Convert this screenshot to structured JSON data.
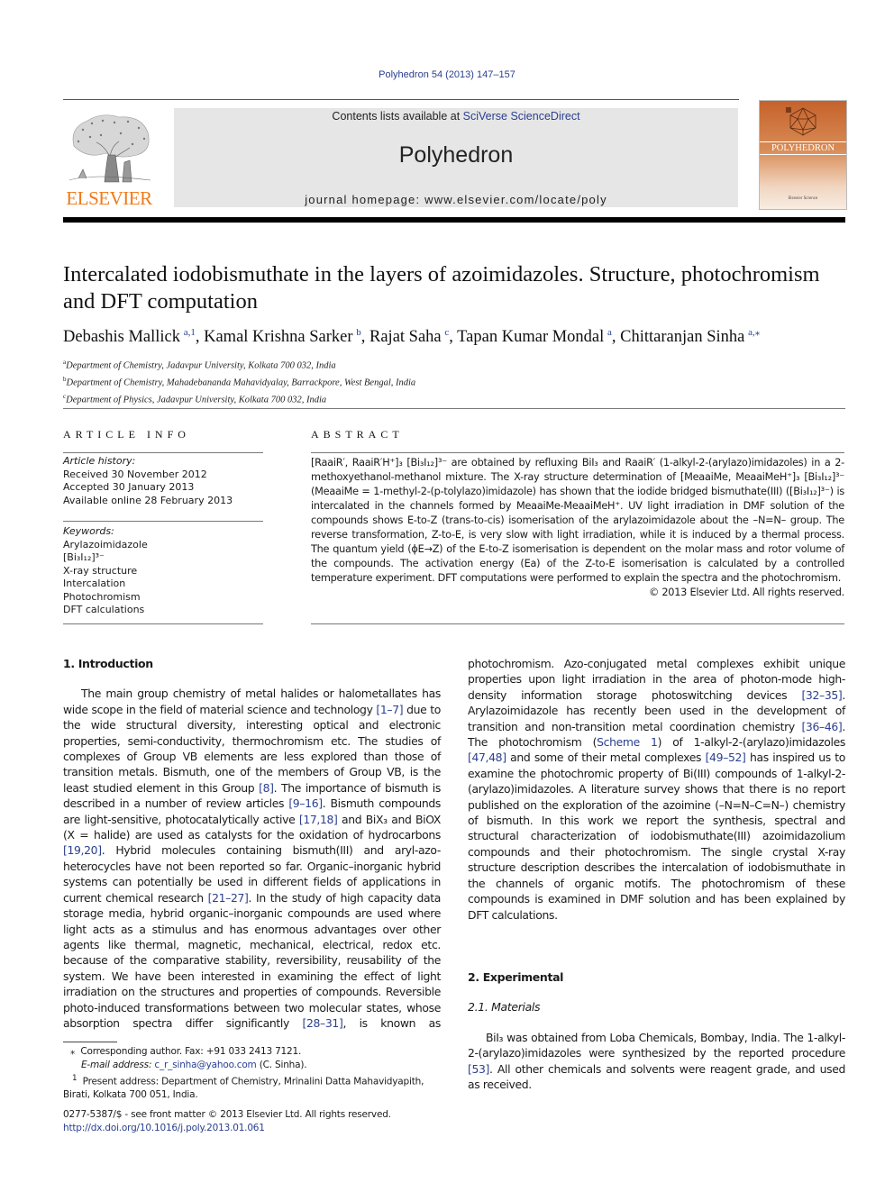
{
  "header": {
    "citation": "Polyhedron 54 (2013) 147–157",
    "contents_prefix": "Contents lists available at ",
    "contents_link": "SciVerse ScienceDirect",
    "journal_name": "Polyhedron",
    "homepage_prefix": "journal homepage: ",
    "homepage_url": "www.elsevier.com/locate/poly",
    "publisher_logo_text": "ELSEVIER",
    "cover_title": "POLYHEDRON",
    "cover_publisher": "Elsevier Science"
  },
  "article": {
    "title": "Intercalated iodobismuthate in the layers of azoimidazoles. Structure, photochromism and DFT computation",
    "authors": [
      {
        "name": "Debashis Mallick",
        "sup": "a,1",
        "sep": ", "
      },
      {
        "name": "Kamal Krishna Sarker",
        "sup": "b",
        "sep": ", "
      },
      {
        "name": "Rajat Saha",
        "sup": "c",
        "sep": ", "
      },
      {
        "name": "Tapan Kumar Mondal",
        "sup": "a",
        "sep": ", "
      },
      {
        "name": "Chittaranjan Sinha",
        "sup": "a,⁎",
        "sep": ""
      }
    ],
    "affiliations": [
      {
        "key": "a",
        "text": "Department of Chemistry, Jadavpur University, Kolkata 700 032, India"
      },
      {
        "key": "b",
        "text": "Department of Chemistry, Mahadebananda Mahavidyalay, Barrackpore, West Bengal, India"
      },
      {
        "key": "c",
        "text": "Department of Physics, Jadavpur University, Kolkata 700 032, India"
      }
    ]
  },
  "article_info": {
    "heading": "ARTICLE INFO",
    "history_label": "Article history:",
    "history": [
      "Received 30 November 2012",
      "Accepted 30 January 2013",
      "Available online 28 February 2013"
    ],
    "keywords_label": "Keywords:",
    "keywords": [
      "Arylazoimidazole",
      "[Bi₃I₁₂]³⁻",
      "X-ray structure",
      "Intercalation",
      "Photochromism",
      "DFT calculations"
    ]
  },
  "abstract": {
    "heading": "ABSTRACT",
    "text": "[RaaiR′, RaaiR′H⁺]₃ [Bi₃I₁₂]³⁻ are obtained by refluxing BiI₃ and RaaiR′ (1-alkyl-2-(arylazo)imidazoles) in a 2-methoxyethanol-methanol mixture. The X-ray structure determination of [MeaaiMe, MeaaiMeH⁺]₃ [Bi₃I₁₂]³⁻ (MeaaiMe = 1-methyl-2-(p-tolylazo)imidazole) has shown that the iodide bridged bismuthate(III) ([Bi₃I₁₂]³⁻) is intercalated in the channels formed by MeaaiMe-MeaaiMeH⁺. UV light irradiation in DMF solution of the compounds shows E-to-Z (trans-to-cis) isomerisation of the arylazoimidazole about the –N=N– group. The reverse transformation, Z-to-E, is very slow with light irradiation, while it is induced by a thermal process. The quantum yield (ϕE→Z) of the E-to-Z isomerisation is dependent on the molar mass and rotor volume of the compounds. The activation energy (Ea) of the Z-to-E isomerisation is calculated by a controlled temperature experiment. DFT computations were performed to explain the spectra and the photochromism.",
    "copyright": "© 2013 Elsevier Ltd. All rights reserved."
  },
  "body": {
    "intro_heading": "1. Introduction",
    "intro_p1": [
      {
        "t": "The main group chemistry of metal halides or halometallates has wide scope in the field of material science and technology "
      },
      {
        "r": "[1–7]"
      },
      {
        "t": " due to the wide structural diversity, interesting optical and electronic properties, semi-conductivity, thermochromism etc. The studies of complexes of Group VB elements are less explored than those of transition metals. Bismuth, one of the members of Group VB, is the least studied element in this Group "
      },
      {
        "r": "[8]"
      },
      {
        "t": ". The importance of bismuth is described in a number of review articles "
      },
      {
        "r": "[9–16]"
      },
      {
        "t": ". Bismuth compounds are light-sensitive, photocatalytically active "
      },
      {
        "r": "[17,18]"
      },
      {
        "t": " and BiX₃ and BiOX (X = halide) are used as catalysts for the oxidation of hydrocarbons "
      },
      {
        "r": "[19,20]"
      },
      {
        "t": ". Hybrid molecules containing bismuth(III) and aryl-azo-heterocycles have not been reported so far. Organic–inorganic hybrid systems can potentially be used in different fields of applications in current chemical research "
      },
      {
        "r": "[21–27]"
      },
      {
        "t": ". In the study of high capacity data storage media, hybrid organic–inorganic compounds are used where light acts as a stimulus and has enormous advantages over other agents like thermal, magnetic, mechanical, electrical, redox etc. because of the comparative stability, reversibility, reusability of the system. We have been interested in examining the effect of light irradiation on the structures and properties of compounds. Reversible photo-induced transformations between two molecular states, whose absorption spectra differ significantly "
      },
      {
        "r": "[28–31]"
      },
      {
        "t": ", is known as photochromism. Azo-conjugated metal complexes exhibit unique properties upon light irradiation in the area of photon-mode high-density information storage photoswitching devices "
      },
      {
        "r": "[32–35]"
      },
      {
        "t": ". Arylazoimidazole has recently been used in the development of transition and non-transition metal coordination chemistry "
      },
      {
        "r": "[36–46]"
      },
      {
        "t": ". The photochromism ("
      },
      {
        "r": "Scheme 1"
      },
      {
        "t": ") of 1-alkyl-2-(arylazo)imidazoles "
      },
      {
        "r": "[47,48]"
      },
      {
        "t": " and some of their metal complexes "
      },
      {
        "r": "[49–52]"
      },
      {
        "t": " has inspired us to examine the photochromic property of Bi(III) compounds of 1-alkyl-2-(arylazo)imidazoles. A literature survey shows that there is no report published on the exploration of the azoimine (–N=N–C=N–) chemistry of bismuth. In this work we report the synthesis, spectral and structural characterization of iodobismuthate(III) azoimidazolium compounds and their photochromism. The single crystal X-ray structure description describes the intercalation of iodobismuthate in the channels of organic motifs. The photochromism of these compounds is examined in DMF solution and has been explained by DFT calculations."
      }
    ],
    "left_col_text": "The main group chemistry of metal halides or halometallates has wide scope in the field of material science and technology",
    "exp_heading": "2. Experimental",
    "materials_heading": "2.1. Materials",
    "materials_p": [
      {
        "t": "BiI₃ was obtained from Loba Chemicals, Bombay, India. The 1-alkyl-2-(arylazo)imidazoles were synthesized by the reported procedure "
      },
      {
        "r": "[53]"
      },
      {
        "t": ". All other chemicals and solvents were reagent grade, and used as received."
      }
    ]
  },
  "footnotes": {
    "corr_mark": "⁎",
    "corr_text": "Corresponding author. Fax: +91 033 2413 7121.",
    "email_label": "E-mail address: ",
    "email": "c_r_sinha@yahoo.com",
    "email_suffix": " (C. Sinha).",
    "present_mark": "1",
    "present_text": "Present address: Department of Chemistry, Mrinalini Datta Mahavidyapith, Birati, Kolkata 700 051, India."
  },
  "front_matter": {
    "issn_line": "0277-5387/$ - see front matter © 2013 Elsevier Ltd. All rights reserved.",
    "doi": "http://dx.doi.org/10.1016/j.poly.2013.01.061"
  },
  "colors": {
    "link": "#2a3f8f",
    "elsevier_orange": "#f07a17",
    "banner_gray": "#e6e6e6"
  }
}
